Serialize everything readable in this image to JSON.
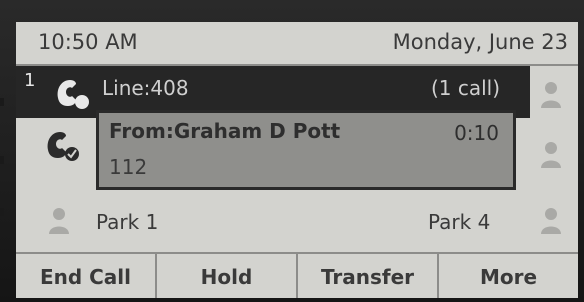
{
  "status": {
    "time": "10:50 AM",
    "date": "Monday, June 23"
  },
  "line": {
    "number": "1",
    "label": "Line:408",
    "call_count": "(1 call)"
  },
  "active_call": {
    "from": "From:Graham D Pott",
    "timer": "0:10",
    "number": "112"
  },
  "park": {
    "left_label": "Park 1",
    "right_label": "Park 4"
  },
  "softkeys": [
    "End Call",
    "Hold",
    "Transfer",
    "More"
  ],
  "icons": {
    "line_status": "phone-handset-icon",
    "held_status": "phone-handset-check-icon",
    "buddy": "person-icon"
  },
  "colors": {
    "screen_bg": "#d3d3cf",
    "highlight_bg": "#262626",
    "call_box_bg": "#8f8f8c"
  }
}
